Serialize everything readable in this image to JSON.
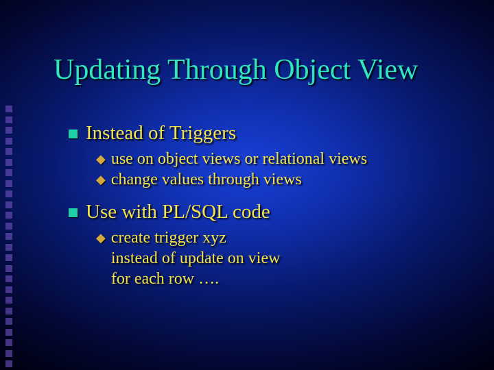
{
  "title": "Updating Through Object View",
  "points": [
    {
      "text": "Instead of Triggers",
      "sub": [
        "use on object views or relational views",
        "change values through views"
      ]
    },
    {
      "text": "Use with PL/SQL code",
      "sub": [
        "create trigger xyz\ninstead of update on view\nfor each row …."
      ]
    }
  ]
}
